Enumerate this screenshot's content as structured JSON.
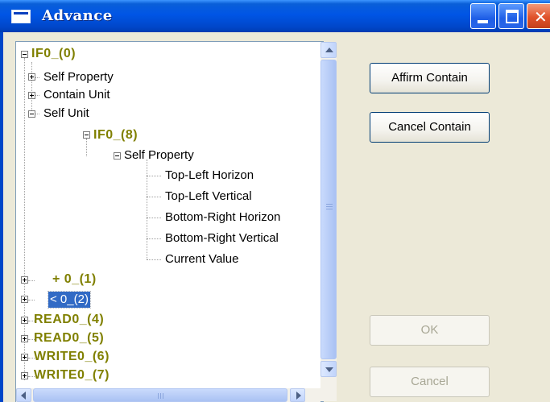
{
  "window": {
    "title": "Advance"
  },
  "tree": {
    "nodes": [
      {
        "label": "IF0_(0)",
        "expander": "minus"
      },
      {
        "label": "Self Property",
        "expander": "plus"
      },
      {
        "label": "Contain Unit",
        "expander": "plus"
      },
      {
        "label": "Self Unit",
        "expander": "minus"
      },
      {
        "label": "IF0_(8)",
        "expander": "minus"
      },
      {
        "label": "Self Property",
        "expander": "minus"
      },
      {
        "label": "Top-Left Horizon"
      },
      {
        "label": "Top-Left Vertical"
      },
      {
        "label": "Bottom-Right Horizon"
      },
      {
        "label": "Bottom-Right Vertical"
      },
      {
        "label": "Current Value"
      },
      {
        "label": "+ 0_(1)",
        "expander": "plus"
      },
      {
        "label": "< 0_(2)",
        "expander": "plus",
        "selected": true
      },
      {
        "label": "READ0_(4)",
        "expander": "plus"
      },
      {
        "label": "READ0_(5)",
        "expander": "plus"
      },
      {
        "label": "WRITE0_(6)",
        "expander": "plus"
      },
      {
        "label": "WRITE0_(7)",
        "expander": "plus"
      }
    ]
  },
  "buttons": {
    "affirm_contain": "Affirm Contain",
    "cancel_contain": "Cancel Contain",
    "ok": "OK",
    "cancel": "Cancel"
  },
  "colors": {
    "titlebar": "#0055e5",
    "tree_label_bold": "#808000",
    "selection": "#316ac5"
  }
}
